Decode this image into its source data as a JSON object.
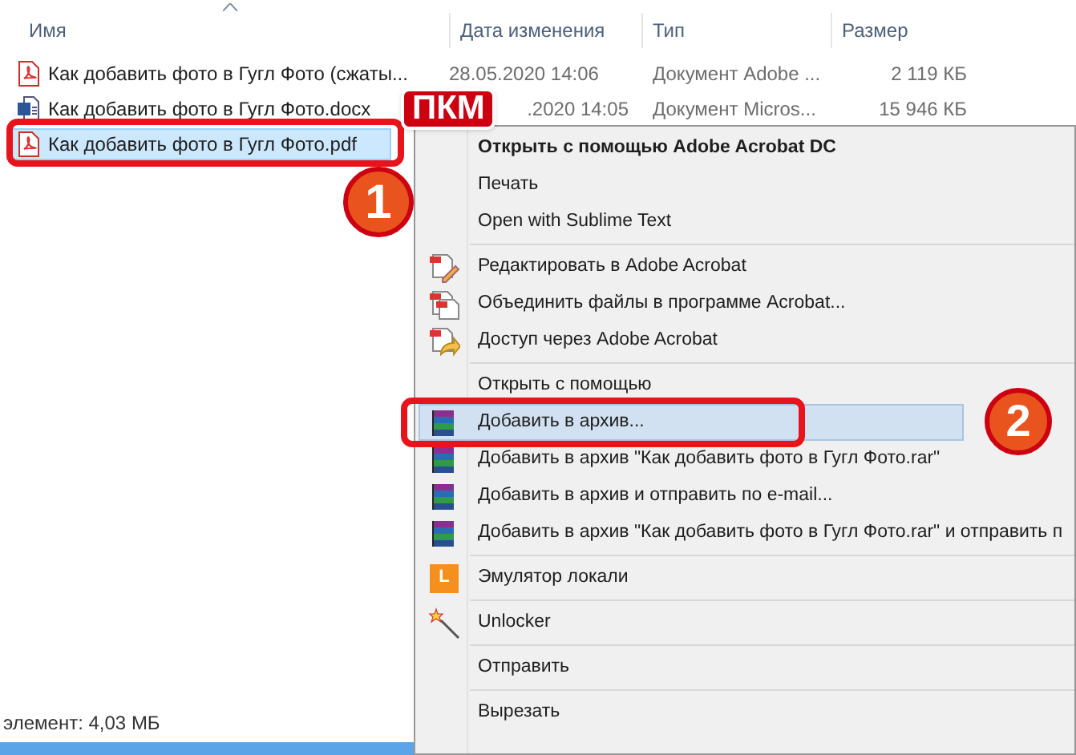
{
  "columns": [
    "Имя",
    "Дата изменения",
    "Тип",
    "Размер"
  ],
  "files": [
    {
      "name": "Как добавить фото в Гугл Фото (сжаты...",
      "date": "28.05.2020 14:06",
      "type": "Документ Adobe ...",
      "size": "2 119 КБ",
      "selected": false
    },
    {
      "name": "Как добавить фото в Гугл Фото.docx",
      "date": ".2020 14:05",
      "type": "Документ Micros...",
      "size": "15 946 КБ",
      "selected": false
    },
    {
      "name": "Как добавить фото в Гугл Фото.pdf",
      "selected": true
    }
  ],
  "status_bar": "элемент: 4,03 МБ",
  "callouts": [
    {
      "label": "ПКМ"
    },
    {
      "label": "1"
    },
    {
      "label": "2"
    }
  ],
  "context_menu": [
    {
      "kind": "item",
      "label": "Открыть с помощью Adobe Acrobat DC",
      "bold": true,
      "selected": false
    },
    {
      "kind": "item",
      "label": "Печать",
      "selected": false
    },
    {
      "kind": "item",
      "label": "Open with Sublime Text",
      "selected": false
    },
    {
      "kind": "separator"
    },
    {
      "kind": "item",
      "label": "Редактировать в Adobe Acrobat",
      "selected": false
    },
    {
      "kind": "item",
      "label": "Объединить файлы в программе Acrobat...",
      "selected": false
    },
    {
      "kind": "item",
      "label": "Доступ через Adobe Acrobat",
      "selected": false
    },
    {
      "kind": "separator"
    },
    {
      "kind": "item",
      "label": "Открыть с помощью",
      "selected": false
    },
    {
      "kind": "item",
      "label": "Добавить в архив...",
      "selected": true
    },
    {
      "kind": "item",
      "label": "Добавить в архив \"Как добавить фото в Гугл Фото.rar\"",
      "selected": false
    },
    {
      "kind": "item",
      "label": "Добавить в архив и отправить по e-mail...",
      "selected": false
    },
    {
      "kind": "item",
      "label": "Добавить в архив \"Как добавить фото в Гугл Фото.rar\" и отправить п",
      "selected": false
    },
    {
      "kind": "separator"
    },
    {
      "kind": "item",
      "label": "Эмулятор локали",
      "icon_text": "L",
      "selected": false
    },
    {
      "kind": "separator"
    },
    {
      "kind": "item",
      "label": "Unlocker",
      "selected": false
    },
    {
      "kind": "separator"
    },
    {
      "kind": "item",
      "label": "Отправить",
      "selected": false
    },
    {
      "kind": "separator"
    },
    {
      "kind": "item",
      "label": "Вырезать",
      "selected": false
    }
  ]
}
